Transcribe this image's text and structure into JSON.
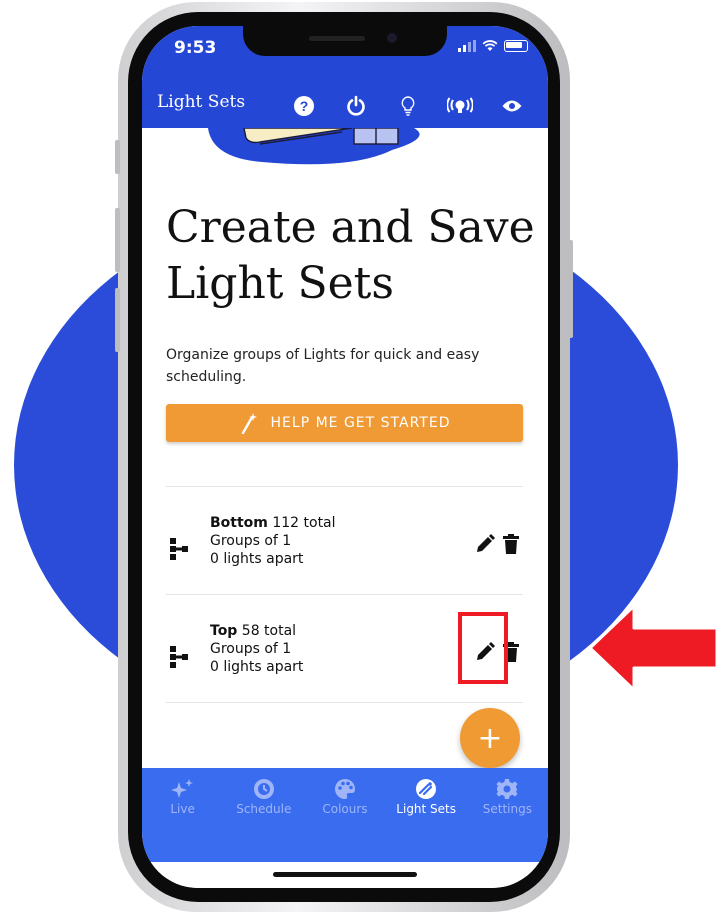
{
  "status_bar": {
    "time": "9:53"
  },
  "app_bar": {
    "title": "Light Sets",
    "actions": [
      "help-icon",
      "power-icon",
      "bulb-icon",
      "broadcast-icon",
      "eye-icon"
    ]
  },
  "hero": {
    "title": "Create and Save Light Sets",
    "description": "Organize groups of Lights for quick and easy scheduling."
  },
  "help_button": {
    "label": "HELP ME GET STARTED",
    "icon": "magic-wand-icon",
    "color": "#ef9a35"
  },
  "light_sets": [
    {
      "name": "Bottom",
      "total": "112 total",
      "groups": "Groups of 1",
      "spacing": "0 lights apart"
    },
    {
      "name": "Top",
      "total": "58 total",
      "groups": "Groups of 1",
      "spacing": "0 lights apart"
    }
  ],
  "fab": {
    "label": "+"
  },
  "tabs": [
    {
      "label": "Live",
      "icon": "sparkles-icon",
      "active": false
    },
    {
      "label": "Schedule",
      "icon": "schedule-icon",
      "active": false
    },
    {
      "label": "Colours",
      "icon": "palette-icon",
      "active": false
    },
    {
      "label": "Light Sets",
      "icon": "light-sets-icon",
      "active": true
    },
    {
      "label": "Settings",
      "icon": "gear-icon",
      "active": false
    }
  ],
  "colors": {
    "primary": "#2547d6",
    "tabbar": "#3a6cf0",
    "accent": "#ef9a35",
    "highlight": "#ee1b24"
  }
}
